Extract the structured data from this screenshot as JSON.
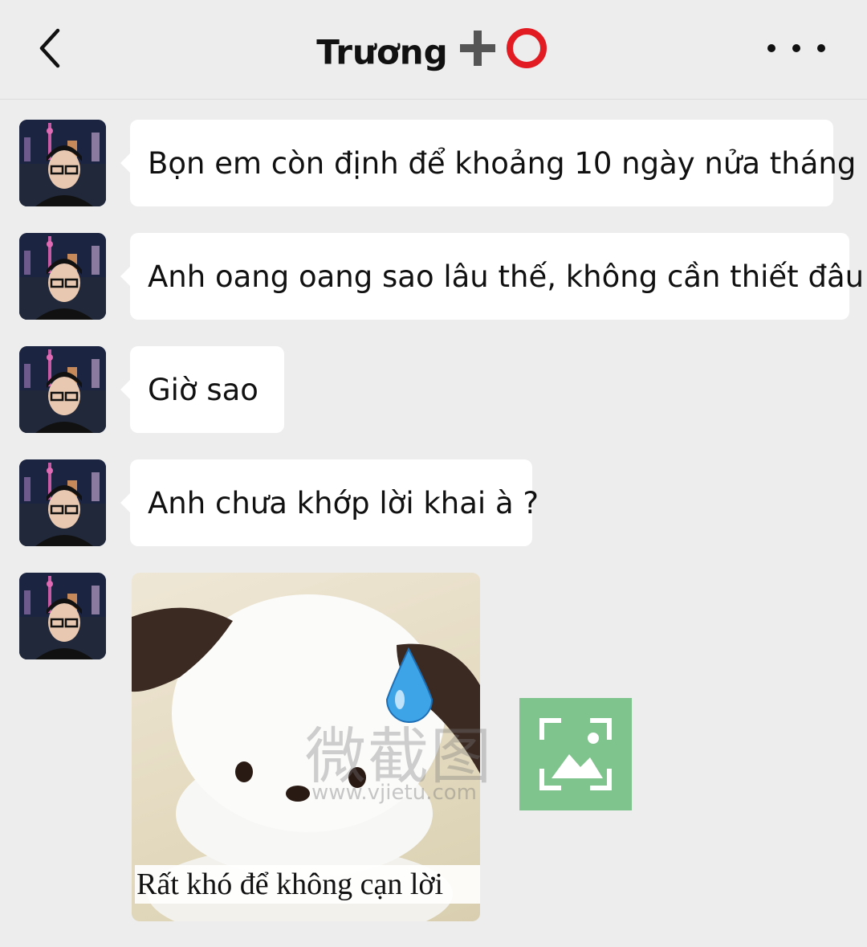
{
  "header": {
    "title": "Trương",
    "title_emoji": "➕⭕",
    "back_icon": "chevron-left-icon",
    "more_icon": "more-dots-icon"
  },
  "messages": [
    {
      "sender": "Trương",
      "text": "Bọn em còn định để khoảng 10 ngày nửa tháng"
    },
    {
      "sender": "Trương",
      "text": "Anh oang oang sao lâu thế, không cần thiết đâu"
    },
    {
      "sender": "Trương",
      "text": "Giờ sao"
    },
    {
      "sender": "Trương",
      "text": "Anh chưa khớp lời khai à ?"
    }
  ],
  "sticker": {
    "caption": "Rất khó để không cạn lời",
    "emoji": "💧"
  },
  "watermark": {
    "text": "微截图",
    "url": "www.vjietu.com"
  },
  "colors": {
    "background": "#ededed",
    "bubble": "#ffffff",
    "watermark_logo": "#7fc38d"
  }
}
